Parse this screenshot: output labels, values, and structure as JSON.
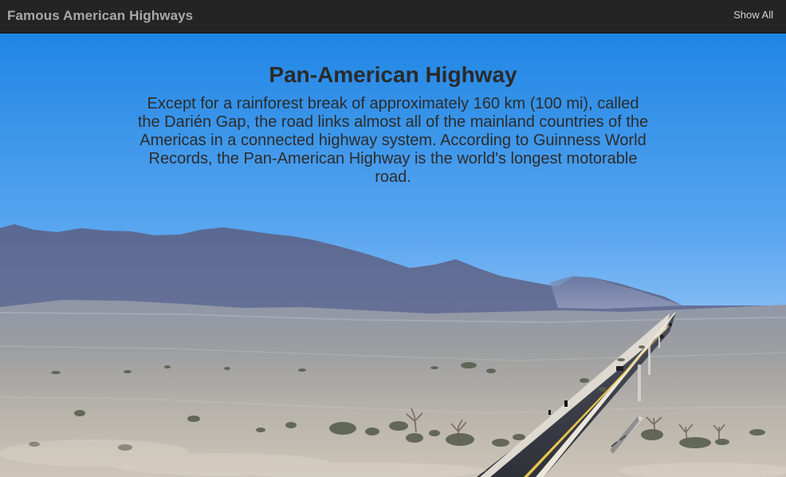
{
  "app": {
    "title": "Famous American Highways",
    "show_all_label": "Show All"
  },
  "hero": {
    "title": "Pan-American Highway",
    "description": "Except for a rainforest break of approximately 160 km (100 mi), called the Darién Gap, the road links almost all of the mainland countries of the Americas in a connected highway system. According to Guinness World Records, the Pan-American Highway is the world's longest motorable road."
  },
  "icons": {
    "background": "mountain-desert-highway-photo"
  },
  "colors": {
    "topbar": "#242424",
    "brand_text": "#a8a8a8",
    "show_all_text": "#d6d6d6",
    "sky": "#2d8ee8",
    "headline": "#2a2a2a"
  }
}
